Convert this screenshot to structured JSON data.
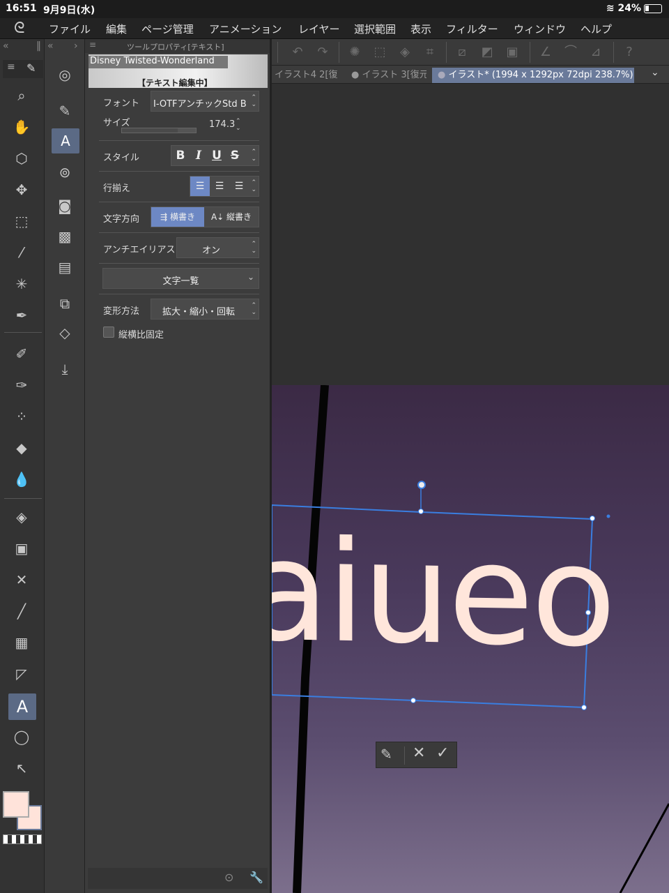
{
  "status": {
    "time": "16:51",
    "date": "9月9日(水)",
    "battery": "24%"
  },
  "menu": [
    "ファイル",
    "編集",
    "ページ管理",
    "アニメーション",
    "レイヤー",
    "選択範囲",
    "表示",
    "フィルター",
    "ウィンドウ",
    "ヘルプ"
  ],
  "tabs": [
    "イラスト4 2[復",
    "イラスト 3[復元",
    "イラスト* (1994 x 1292px 72dpi 238.7%)"
  ],
  "panel": {
    "title": "ツールプロパティ[テキスト]",
    "preview_font": "Disney Twisted-Wonderland",
    "editing": "【テキスト編集中】",
    "font_label": "フォント",
    "font_value": "I-OTFアンチックStd B",
    "size_label": "サイズ",
    "size_value": "174.3",
    "style_label": "スタイル",
    "style_bold": "B",
    "style_italic": "I",
    "style_underline": "U",
    "style_strike": "S",
    "align_label": "行揃え",
    "direction_label": "文字方向",
    "direction_h": "横書き",
    "direction_v": "縦書き",
    "aa_label": "アンチエイリアス",
    "aa_value": "オン",
    "charlist": "文字一覧",
    "transform_label": "変形方法",
    "transform_value": "拡大・縮小・回転",
    "ratio_label": "縦横比固定"
  },
  "canvas": {
    "text": "aiueo",
    "text_color": "#ffe6db"
  },
  "colors": {
    "main": "#ffe3da",
    "sub": "#ffe3da",
    "accent": "#4a8fe0"
  }
}
